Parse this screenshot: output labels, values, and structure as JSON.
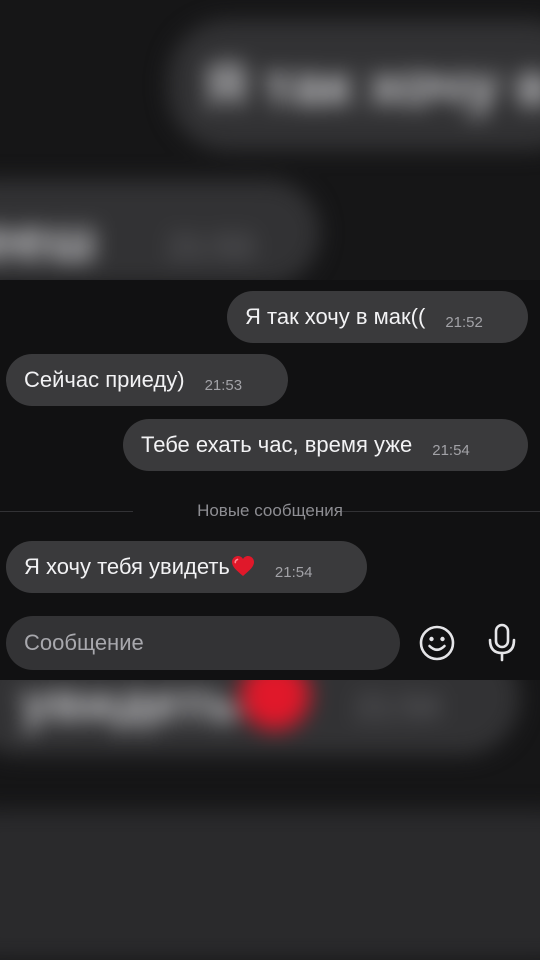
{
  "background_top": {
    "message_text": "Я так хочу в мак((",
    "partial_word": "ееш",
    "time": "21:53"
  },
  "background_bottom": {
    "partial_word": "увидеть",
    "time": "21:54"
  },
  "messages": [
    {
      "direction": "outgoing",
      "text": "Я так хочу в мак((",
      "time": "21:52"
    },
    {
      "direction": "incoming",
      "text": "Сейчас приеду)",
      "time": "21:53"
    },
    {
      "direction": "outgoing",
      "text": "Тебе ехать час, время уже",
      "time": "21:54"
    },
    {
      "direction": "incoming",
      "text": "Я хочу тебя увидеть",
      "time": "21:54",
      "emoji": "heart-icon"
    }
  ],
  "new_messages_divider": "Новые сообщения",
  "composer": {
    "placeholder": "Сообщение",
    "emoji_button": "smiley-icon",
    "voice_button": "microphone-icon"
  },
  "colors": {
    "background": "#161617",
    "bubble": "#3a3a3c",
    "text": "#f2f2f4",
    "timestamp": "#a2a2a7",
    "heart": "#e0182a"
  }
}
